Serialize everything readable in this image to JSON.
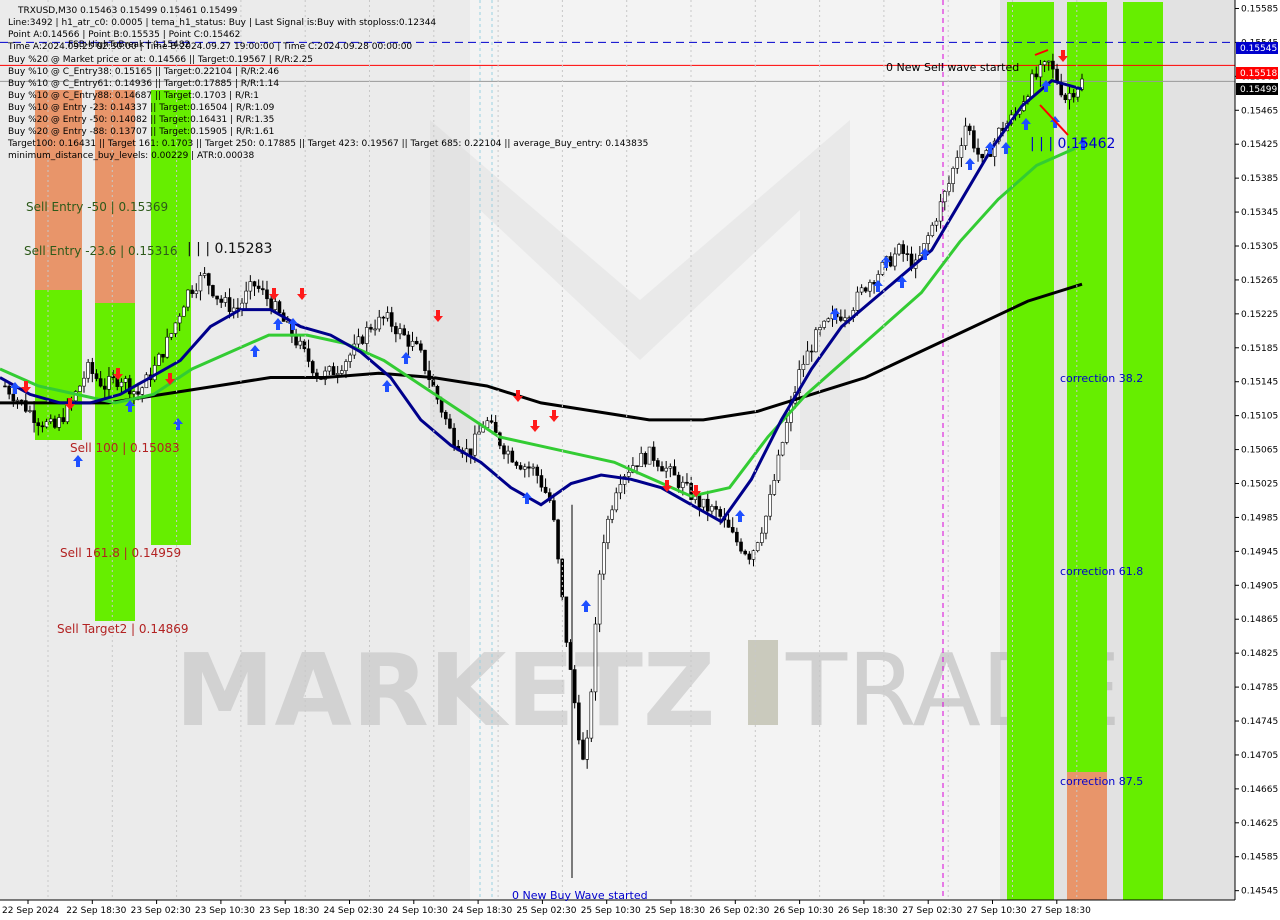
{
  "header": {
    "symbol_line": "TRXUSD,M30  0.15463 0.15499 0.15461 0.15499",
    "info_lines": [
      "Line:3492 | h1_atr_c0: 0.0005 | tema_h1_status: Buy | Last Signal is:Buy with stoploss:0.12344",
      "Point A:0.14566 | Point B:0.15535 | Point C:0.15462",
      "Time A:2024.09.25 02:30:00 | Time B:2024.09.27 19:00:00 | Time C:2024.09.28 00:00:00",
      "Buy %20 @ Market price or at: 0.14566 || Target:0.19567 | R/R:2.25",
      "Buy %10 @ C_Entry38: 0.15165 || Target:0.22104 | R/R:2.46",
      "Buy %10 @ C_Entry61: 0.14936 || Target:0.17885 | R/R:1.14",
      "Buy %10 @ C_Entry88: 0.14687 || Target:0.1703 | R/R:1",
      "Buy %10 @ Entry -23: 0.14337 || Target:0.16504 | R/R:1.09",
      "Buy %20 @ Entry -50: 0.14082 || Target:0.16431 | R/R:1.35",
      "Buy %20 @ Entry -88: 0.13707 || Target:0.15905 | R/R:1.61",
      "Target100: 0.16431 || Target 161: 0.1703 || Target 250: 0.17885 || Target 423: 0.19567 || Target 685: 0.22104 || average_Buy_entry: 0.143835",
      "minimum_distance_buy_levels: 0.00229 | ATR:0.00038"
    ],
    "overlap_label": "FSB-HighToBreak | 0.15482"
  },
  "price_tags": {
    "top_blue": "0.15545",
    "red": "0.15518",
    "current": "0.15499"
  },
  "annotations": {
    "sell_entry_50": "Sell Entry -50 | 0.15369",
    "sell_entry_236": "Sell Entry -23.6 | 0.15316",
    "level_15283": "| | | 0.15283",
    "sell_100": "Sell 100 | 0.15083",
    "sell_1618": "Sell 161.8 | 0.14959",
    "sell_target2": "Sell Target2 | 0.14869",
    "new_sell_wave": "0 New Sell wave started",
    "new_buy_wave": "0 New Buy Wave started",
    "point_c_label": "| | | 0.15462",
    "correction_382": "correction 38.2",
    "correction_618": "correction 61.8",
    "correction_875": "correction 87.5"
  },
  "watermark": {
    "text_left": "MARKETZ",
    "text_right": "TRADE"
  },
  "colors": {
    "green_zone": "#66ee00",
    "orange_zone": "#e8956a",
    "ma_blue": "#00008b",
    "ma_green": "#33cc33",
    "ma_black": "#000000",
    "stop_orange": "#ff4500",
    "tag_blue": "#0000cd",
    "tag_red": "#ff0000",
    "tag_current": "#000000",
    "sell_text": "#b22222",
    "annotation_blue": "#0000ff"
  },
  "chart_data": {
    "type": "candlestick",
    "symbol": "TRXUSD",
    "timeframe": "M30",
    "ylim": [
      0.14534,
      0.15595
    ],
    "y_ticks": [
      "0.15585",
      "0.15545",
      "0.15505",
      "0.15465",
      "0.15425",
      "0.15385",
      "0.15345",
      "0.15305",
      "0.15265",
      "0.15225",
      "0.15185",
      "0.15145",
      "0.15105",
      "0.15065",
      "0.15025",
      "0.14985",
      "0.14945",
      "0.14905",
      "0.14865",
      "0.14825",
      "0.14785",
      "0.14745",
      "0.14705",
      "0.14665",
      "0.14625",
      "0.14585",
      "0.14545"
    ],
    "x_ticks": [
      "22 Sep 2024",
      "22 Sep 18:30",
      "23 Sep 02:30",
      "23 Sep 10:30",
      "23 Sep 18:30",
      "24 Sep 02:30",
      "24 Sep 10:30",
      "24 Sep 18:30",
      "25 Sep 02:30",
      "25 Sep 10:30",
      "25 Sep 18:30",
      "26 Sep 02:30",
      "26 Sep 10:30",
      "26 Sep 18:30",
      "27 Sep 02:30",
      "27 Sep 10:30",
      "27 Sep 18:30"
    ],
    "ohlc_last": {
      "open": 0.15463,
      "high": 0.15499,
      "low": 0.15461,
      "close": 0.15499
    },
    "close_path": [
      0.1514,
      0.1512,
      0.151,
      0.1509,
      0.1512,
      0.1516,
      0.1514,
      0.1515,
      0.1513,
      0.1516,
      0.152,
      0.1525,
      0.1527,
      0.1524,
      0.1523,
      0.1526,
      0.1524,
      0.1521,
      0.1518,
      0.1515,
      0.1516,
      0.1518,
      0.1521,
      0.1522,
      0.152,
      0.1518,
      0.1513,
      0.1508,
      0.1506,
      0.151,
      0.1507,
      0.1505,
      0.1504,
      0.15,
      0.1482,
      0.1468,
      0.1495,
      0.1503,
      0.1505,
      0.1506,
      0.1504,
      0.1502,
      0.15,
      0.1499,
      0.1496,
      0.1494,
      0.1499,
      0.1508,
      0.1516,
      0.152,
      0.1522,
      0.1523,
      0.1526,
      0.1528,
      0.153,
      0.1528,
      0.1533,
      0.1538,
      0.1545,
      0.154,
      0.1544,
      0.1546,
      0.155,
      0.1552,
      0.1548,
      0.15499
    ],
    "ma_fast": [
      0.1515,
      0.1513,
      0.1512,
      0.1512,
      0.1513,
      0.1515,
      0.1517,
      0.1521,
      0.1523,
      0.1523,
      0.1521,
      0.152,
      0.1518,
      0.1515,
      0.151,
      0.1507,
      0.1505,
      0.1502,
      0.15,
      0.15025,
      0.15035,
      0.1503,
      0.1502,
      0.15,
      0.1498,
      0.1503,
      0.151,
      0.1516,
      0.1521,
      0.1524,
      0.1527,
      0.153,
      0.1536,
      0.1542,
      0.1547,
      0.155,
      0.1549
    ],
    "ma_mid": [
      0.1516,
      0.1514,
      0.1513,
      0.1512,
      0.1513,
      0.1516,
      0.1518,
      0.152,
      0.152,
      0.1519,
      0.1517,
      0.1514,
      0.1511,
      0.1508,
      0.1507,
      0.1506,
      0.1505,
      0.1503,
      0.1501,
      0.1502,
      0.1508,
      0.1513,
      0.1517,
      0.1521,
      0.1525,
      0.1531,
      0.1536,
      0.154,
      0.1542
    ],
    "ma_slow": [
      0.1512,
      0.1512,
      0.1512,
      0.1513,
      0.1514,
      0.1515,
      0.1515,
      0.15155,
      0.1515,
      0.1514,
      0.1512,
      0.1511,
      0.151,
      0.151,
      0.1511,
      0.1513,
      0.1515,
      0.1518,
      0.1521,
      0.1524,
      0.1526
    ],
    "levels": {
      "top_blue_dashed": 0.15545,
      "red_line": 0.15518,
      "current_line": 0.15499
    }
  }
}
